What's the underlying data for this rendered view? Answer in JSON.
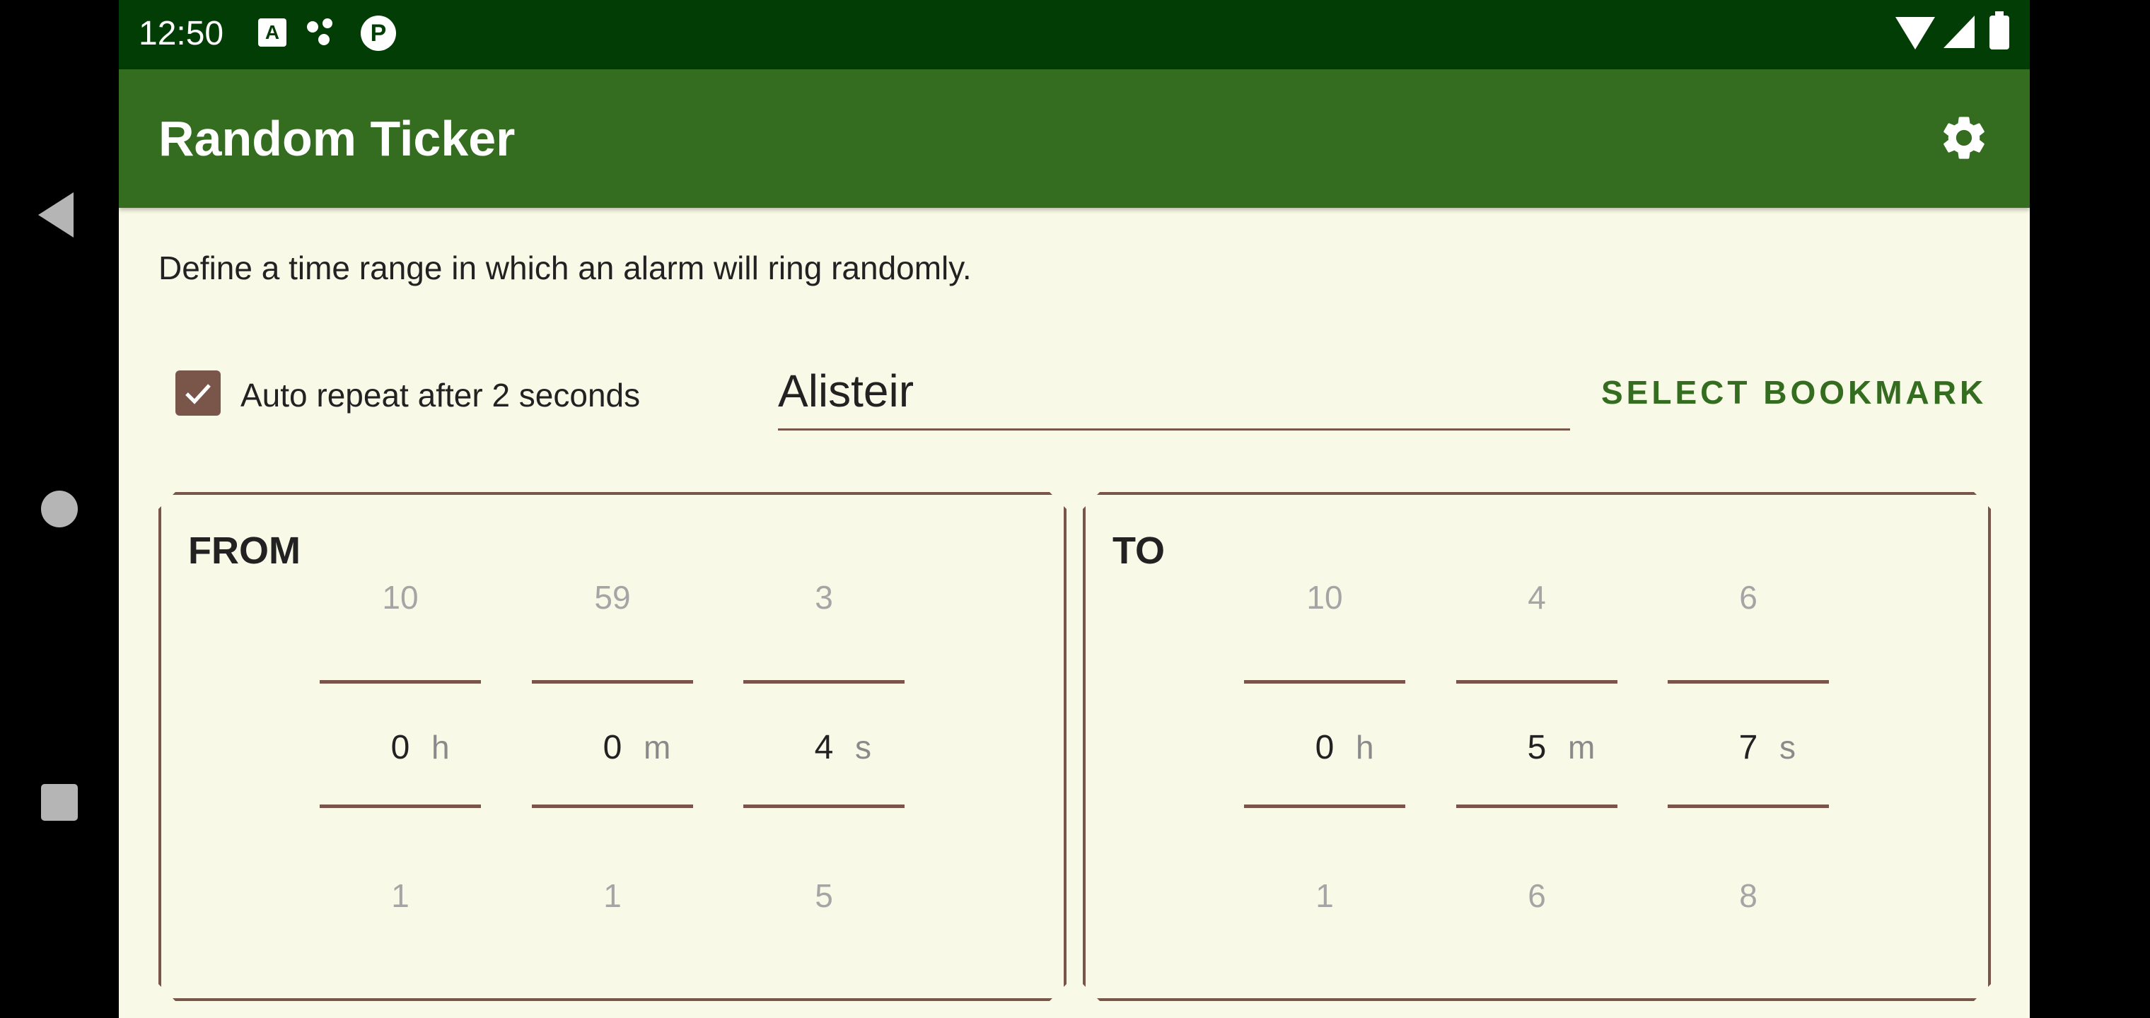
{
  "status_bar": {
    "time": "12:50",
    "icons": [
      "a-icon",
      "dots-icon",
      "p-icon",
      "wifi-icon",
      "signal-icon",
      "battery-icon"
    ]
  },
  "toolbar": {
    "title": "Random Ticker",
    "settings_icon": "gear-icon"
  },
  "description": "Define a time range in which an alarm will ring randomly.",
  "auto_repeat": {
    "checked": true,
    "label": "Auto repeat after 2 seconds"
  },
  "bookmark": {
    "name_value": "Alisteir",
    "select_label": "SELECT BOOKMARK"
  },
  "from": {
    "title": "FROM",
    "hours": {
      "above": "10",
      "value": "0",
      "unit": "h",
      "below": "1"
    },
    "minutes": {
      "above": "59",
      "value": "0",
      "unit": "m",
      "below": "1"
    },
    "seconds": {
      "above": "3",
      "value": "4",
      "unit": "s",
      "below": "5"
    }
  },
  "to": {
    "title": "TO",
    "hours": {
      "above": "10",
      "value": "0",
      "unit": "h",
      "below": "1"
    },
    "minutes": {
      "above": "4",
      "value": "5",
      "unit": "m",
      "below": "6"
    },
    "seconds": {
      "above": "6",
      "value": "7",
      "unit": "s",
      "below": "8"
    }
  },
  "colors": {
    "status_bar": "#013d04",
    "toolbar": "#346c20",
    "background": "#f8f9e6",
    "accent_brown": "#79554a",
    "accent_green": "#346c20"
  }
}
